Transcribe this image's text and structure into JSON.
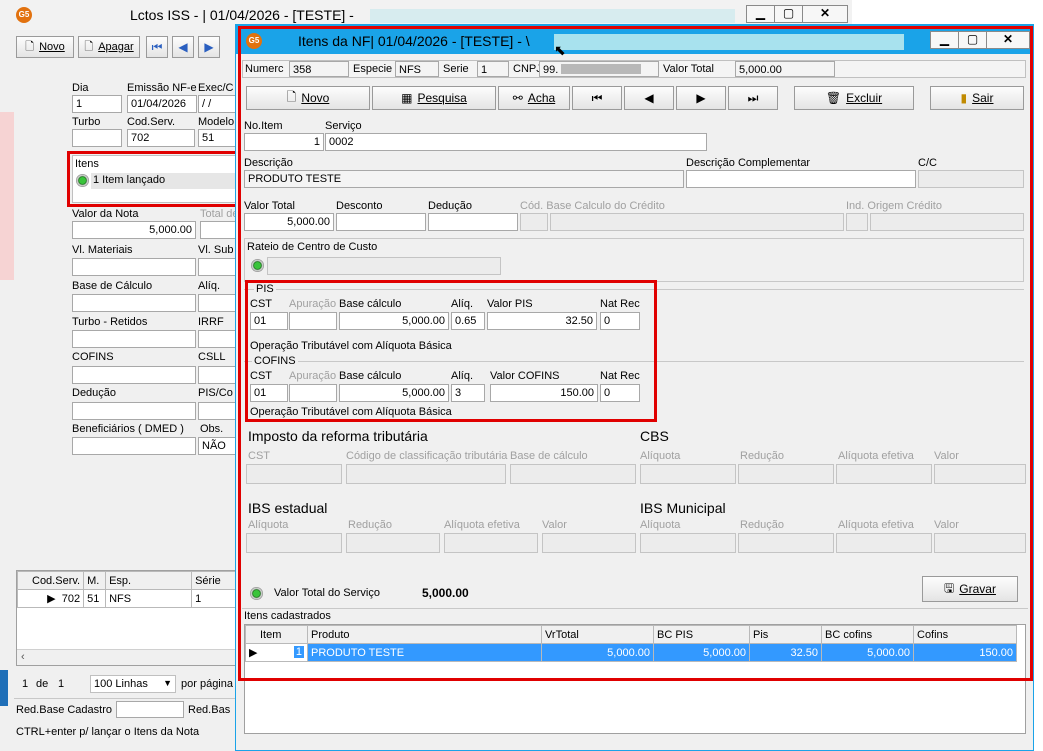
{
  "background_window": {
    "title": "Lctos ISS - |  01/04/2026 - [TESTE] -",
    "toolbar": {
      "novo": "Novo",
      "apagar": "Apagar"
    },
    "fields": {
      "dia_label": "Dia",
      "dia_value": "1",
      "emissao_label": "Emissão NF-e",
      "emissao_value": "01/04/2026",
      "exec_label": "Exec/C",
      "exec_value": " / /",
      "turbo_label": "Turbo",
      "codserv_label": "Cod.Serv.",
      "codserv_value": "702",
      "modelo_label": "Modelo",
      "modelo_value": "51",
      "itens_label": "Itens",
      "itens_value": "1 Item lançado",
      "valor_nota_label": "Valor da Nota",
      "valor_nota_value": "5,000.00",
      "total_label": "Total de",
      "vl_materiais_label": "Vl. Materiais",
      "vl_sub_label": "Vl. Sub",
      "base_calc_label": "Base de Cálculo",
      "aliq_label": "Alíq.",
      "turbo_retidos_label": "Turbo - Retidos",
      "irrf_label": "IRRF",
      "cofins_label": "COFINS",
      "csll_label": "CSLL",
      "deducao_label": "Dedução",
      "pis_co_label": "PIS/Co",
      "benef_label": "Beneficiários ( DMED )",
      "obs_label": "Obs.",
      "obs_value": "NÃO"
    },
    "grid": {
      "headers": [
        "Cod.Serv.",
        "M.",
        "Esp.",
        "Série"
      ],
      "row": [
        "702",
        "51",
        "NFS",
        "1"
      ]
    },
    "pager": {
      "page": "1",
      "de": "de",
      "total": "1",
      "linhas": "100 Linhas",
      "por_pagina": "por página"
    },
    "status": {
      "red_base": "Red.Base Cadastro",
      "red_bas2": "Red.Bas",
      "hint": "CTRL+enter p/ lançar o Itens da Nota"
    }
  },
  "dialog": {
    "title": "Itens da NF|  01/04/2026 - [TESTE] - \\",
    "header": {
      "numero_label": "Numerc",
      "numero_value": "358",
      "especie_label": "Especie",
      "especie_value": "NFS",
      "serie_label": "Serie",
      "serie_value": "1",
      "cnpj_label": "CNPJ",
      "cnpj_value": "99.",
      "valor_total_label": "Valor Total",
      "valor_total_value": "5,000.00"
    },
    "toolbar": {
      "novo": "Novo",
      "pesquisa": "Pesquisa",
      "acha": "Acha",
      "excluir": "Excluir",
      "sair": "Sair"
    },
    "item": {
      "noitem_label": "No.Item",
      "noitem_value": "1",
      "servico_label": "Serviço",
      "servico_value": "0002",
      "descricao_label": "Descrição",
      "descricao_value": "PRODUTO TESTE",
      "desc_comp_label": "Descrição Complementar",
      "cc_label": "C/C",
      "valor_total_label": "Valor Total",
      "valor_total_value": "5,000.00",
      "desconto_label": "Desconto",
      "deducao_label": "Dedução",
      "cod_base_label": "Cód. Base Calculo do Crédito",
      "ind_origem_label": "Ind. Origem Crédito",
      "rateio_label": "Rateio de Centro de Custo"
    },
    "pis": {
      "title": "PIS",
      "cst_label": "CST",
      "cst_value": "01",
      "apuracao_label": "Apuração",
      "base_label": "Base cálculo",
      "base_value": "5,000.00",
      "aliq_label": "Alíq.",
      "aliq_value": "0.65",
      "valor_label": "Valor PIS",
      "valor_value": "32.50",
      "natrec_label": "Nat Rec",
      "natrec_value": "0",
      "desc": "Operação Tributável com Alíquota Básica"
    },
    "cofins": {
      "title": "COFINS",
      "cst_label": "CST",
      "cst_value": "01",
      "apuracao_label": "Apuração",
      "base_label": "Base cálculo",
      "base_value": "5,000.00",
      "aliq_label": "Alíq.",
      "aliq_value": "3",
      "valor_label": "Valor COFINS",
      "valor_value": "150.00",
      "natrec_label": "Nat Rec",
      "natrec_value": "0",
      "desc": "Operação Tributável com Alíquota Básica"
    },
    "reforma": {
      "title": "Imposto da reforma tributária",
      "cst_label": "CST",
      "codigo_label": "Código de classificação tributária",
      "base_label": "Base de cálculo",
      "cbs_title": "CBS",
      "aliquota_label": "Alíquota",
      "reducao_label": "Redução",
      "aliquota_efetiva_label": "Alíquota efetiva",
      "valor_label": "Valor",
      "ibs_estadual_title": "IBS estadual",
      "ibs_municipal_title": "IBS Municipal"
    },
    "footer": {
      "valor_servico_label": "Valor Total do Serviço",
      "valor_servico_value": "5,000.00",
      "gravar": "Gravar"
    },
    "itens_cadastrados": {
      "title": "Itens cadastrados",
      "headers": [
        "Item",
        "Produto",
        "VrTotal",
        "BC PIS",
        "Pis",
        "BC cofins",
        "Cofins"
      ],
      "row": [
        "1",
        "PRODUTO TESTE",
        "5,000.00",
        "5,000.00",
        "32.50",
        "5,000.00",
        "150.00"
      ]
    }
  },
  "colors": {
    "highlight": "#e00000",
    "selection": "#3399ff",
    "dialog_border": "#1aa3e8"
  },
  "icons": [
    "g5-logo-icon",
    "new-doc-icon",
    "search-icon",
    "binoculars-icon",
    "first-icon",
    "prev-icon",
    "next-icon",
    "last-icon",
    "trash-icon",
    "exit-icon",
    "save-icon",
    "radio-green-icon"
  ]
}
